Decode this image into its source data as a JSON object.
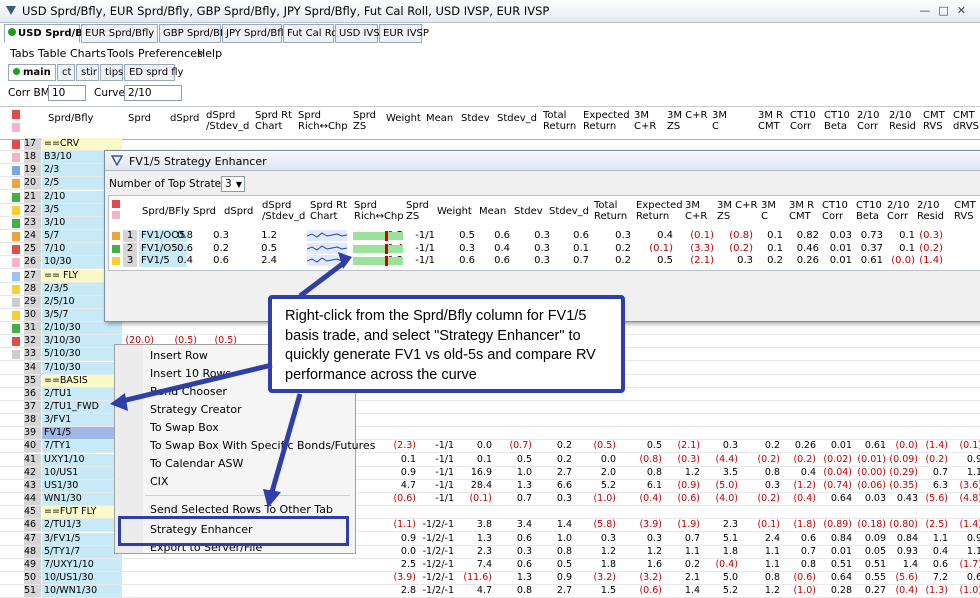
{
  "window": {
    "title": "USD Sprd/Bfly, EUR Sprd/Bfly, GBP Sprd/Bfly, JPY Sprd/Bfly, Fut Cal Roll, USD IVSP, EUR IVSP"
  },
  "tabs": [
    "USD Sprd/Bfly",
    "EUR Sprd/Bfly",
    "GBP Sprd/Bfly",
    "JPY Sprd/Bfly",
    "Fut Cal Roll",
    "USD IVSP",
    "EUR IVSP"
  ],
  "menu": [
    "Tabs",
    "Table",
    "Charts",
    "Tools",
    "Preferences",
    "Help"
  ],
  "subtabs": [
    "main",
    "ct",
    "stir",
    "tips",
    "ED sprd fly"
  ],
  "controls": {
    "corr_label": "Corr BM:",
    "corr_value": "10",
    "curve_label": "Curve:",
    "curve_value": "2/10"
  },
  "grid_headers": [
    "Sprd/Bfly",
    "Sprd",
    "dSprd",
    "dSprd\n/Stdev_d",
    "Sprd Rt\nChart",
    "Sprd\nRich↔Chp",
    "Sprd\nZS",
    "Weight",
    "Mean",
    "Stdev",
    "Stdev_d",
    "Total\nReturn",
    "Expected\nReturn",
    "3M\nC+R",
    "3M C+R\nZS",
    "3M\nC",
    "3M R\nCMT",
    "CT10\nCorr",
    "CT10\nBeta",
    "2/10\nCorr",
    "2/10\nResid",
    "CMT\nRVS",
    "CMT\ndRVS"
  ],
  "rows": [
    {
      "n": "17",
      "label": "==CRV",
      "sec": true
    },
    {
      "n": "18",
      "label": "B3/10"
    },
    {
      "n": "19",
      "label": "2/3"
    },
    {
      "n": "20",
      "label": "2/5"
    },
    {
      "n": "21",
      "label": "2/10"
    },
    {
      "n": "22",
      "label": "3/5"
    },
    {
      "n": "23",
      "label": "3/10"
    },
    {
      "n": "24",
      "label": "5/7"
    },
    {
      "n": "25",
      "label": "7/10"
    },
    {
      "n": "26",
      "label": "10/30"
    },
    {
      "n": "27",
      "label": "== FLY",
      "sec": true
    },
    {
      "n": "28",
      "label": "2/3/5"
    },
    {
      "n": "29",
      "label": "2/5/10"
    },
    {
      "n": "30",
      "label": "3/5/7"
    },
    {
      "n": "31",
      "label": "2/10/30"
    },
    {
      "n": "32",
      "label": "3/10/30",
      "vals": [
        "(20.0)",
        "(0.5)",
        "(0.5)"
      ]
    },
    {
      "n": "33",
      "label": "5/10/30",
      "vals": [
        "(30.5)",
        "(1.4)",
        "(3.0)"
      ]
    },
    {
      "n": "34",
      "label": "7/10/30"
    },
    {
      "n": "35",
      "label": "==BASIS",
      "sec": true
    },
    {
      "n": "36",
      "label": "2/TU1"
    },
    {
      "n": "37",
      "label": "2/TU1_FWD"
    },
    {
      "n": "38",
      "label": "3/FV1"
    },
    {
      "n": "39",
      "label": "FV1/5"
    },
    {
      "n": "40",
      "label": "7/TY1",
      "vals": [
        "(2.3)",
        "-1/1",
        "0.0",
        "(0.7)",
        "0.2",
        "(0.5)",
        "0.5",
        "(2.1)",
        "0.3",
        "0.2",
        "0.26",
        "0.01",
        "0.61",
        "(0.0)",
        "(1.4)",
        "(0.1)"
      ]
    },
    {
      "n": "41",
      "label": "UXY1/10",
      "vals": [
        "0.1",
        "-1/1",
        "0.1",
        "0.5",
        "0.2",
        "0.0",
        "(0.8)",
        "(0.3)",
        "(4.4)",
        "(0.2)",
        "(0.2)",
        "(0.02)",
        "(0.01)",
        "(0.09)",
        "(0.2)",
        "0.9"
      ]
    },
    {
      "n": "42",
      "label": "10/US1",
      "vals": [
        "0.9",
        "-1/1",
        "16.9",
        "1.0",
        "2.7",
        "2.0",
        "0.8",
        "1.2",
        "3.5",
        "0.8",
        "0.4",
        "(0.04)",
        "(0.00)",
        "(0.29)",
        "0.7",
        "1.1"
      ]
    },
    {
      "n": "43",
      "label": "US1/30",
      "vals": [
        "4.7",
        "-1/1",
        "28.4",
        "1.3",
        "6.6",
        "5.2",
        "6.1",
        "(0.9)",
        "(5.0)",
        "0.3",
        "(1.2)",
        "(0.74)",
        "(0.06)",
        "(0.35)",
        "6.3",
        "(3.6)"
      ]
    },
    {
      "n": "44",
      "label": "WN1/30",
      "vals": [
        "(0.6)",
        "-1/1",
        "(0.1)",
        "0.7",
        "0.3",
        "(1.0)",
        "(0.4)",
        "(0.6)",
        "(4.0)",
        "(0.2)",
        "(0.4)",
        "0.64",
        "0.03",
        "0.43",
        "(5.6)",
        "(4.8)"
      ]
    },
    {
      "n": "45",
      "label": "==FUT FLY",
      "sec": true
    },
    {
      "n": "46",
      "label": "2/TU1/3",
      "vals": [
        "(1.1)",
        "-1/2/-1",
        "3.8",
        "3.4",
        "1.4",
        "(5.8)",
        "(3.9)",
        "(1.9)",
        "2.3",
        "(0.1)",
        "(1.8)",
        "(0.89)",
        "(0.18)",
        "(0.80)",
        "(2.5)",
        "(1.4)"
      ]
    },
    {
      "n": "47",
      "label": "3/FV1/5",
      "vals": [
        "0.9",
        "-1/2/-1",
        "1.3",
        "0.6",
        "1.0",
        "0.3",
        "0.3",
        "0.7",
        "5.1",
        "2.4",
        "0.6",
        "0.84",
        "0.09",
        "0.84",
        "1.1",
        "0.9"
      ]
    },
    {
      "n": "48",
      "label": "5/TY1/7",
      "vals": [
        "0.0",
        "-1/2/-1",
        "2.3",
        "0.3",
        "0.8",
        "1.2",
        "1.2",
        "1.1",
        "1.8",
        "1.1",
        "0.7",
        "0.01",
        "0.05",
        "0.93",
        "0.4",
        "1.1"
      ]
    },
    {
      "n": "49",
      "label": "7/UXY1/10",
      "vals": [
        "2.5",
        "-1/2/-1",
        "7.4",
        "0.6",
        "0.5",
        "1.8",
        "1.6",
        "0.2",
        "(0.4)",
        "1.1",
        "0.8",
        "0.51",
        "0.51",
        "1.4",
        "0.6",
        "(1.7)"
      ]
    },
    {
      "n": "50",
      "label": "10/US1/30",
      "vals": [
        "(3.9)",
        "-1/2/-1",
        "(11.6)",
        "1.3",
        "0.9",
        "(3.2)",
        "(3.2)",
        "2.1",
        "5.0",
        "0.8",
        "(0.6)",
        "0.64",
        "0.55",
        "(5.6)",
        "7.2",
        "0.6"
      ]
    },
    {
      "n": "51",
      "label": "10/WN1/30",
      "vals": [
        "2.8",
        "-1/2/-1",
        "4.7",
        "0.8",
        "2.7",
        "1.5",
        "(0.6)",
        "1.4",
        "5.2",
        "1.2",
        "(1.0)",
        "0.28",
        "0.27",
        "(0.4)",
        "(1.3)",
        "(1.0)"
      ]
    }
  ],
  "dialog": {
    "title": "FV1/5 Strategy Enhancer",
    "num_label": "Number of Top Strategies:",
    "num_value": "3",
    "headers": [
      "Sprd/BFly",
      "Sprd",
      "dSprd",
      "dSprd\n/Stdev_d",
      "Sprd Rt\nChart",
      "Sprd\nRich↔Chp",
      "Sprd\nZS",
      "Weight",
      "Mean",
      "Stdev",
      "Stdev_d",
      "Total\nReturn",
      "Expected\nReturn",
      "3M\nC+R",
      "3M C+R\nZS",
      "3M\nC",
      "3M R\nCMT",
      "CT10\nCorr",
      "CT10\nBeta",
      "2/10\nCorr",
      "2/10\nResid",
      "CMT\nRVS"
    ],
    "rows": [
      {
        "n": "1",
        "name": "FV1/OO5",
        "sprd": "0.8",
        "dsprd": "0.3",
        "z": "1.2",
        "zs": "0.5",
        "w": "-1/1",
        "mean": "0.5",
        "stdev": "0.6",
        "stdevd": "0.3",
        "tr": "0.6",
        "er": "0.3",
        "cr": "0.4",
        "crzs": "(0.1)",
        "c": "(0.8)",
        "rcmt": "0.1",
        "ctc": "0.82",
        "ctb": "0.03",
        "tc": "0.73",
        "tr2": "0.1",
        "rvs": "(0.3)"
      },
      {
        "n": "2",
        "name": "FV1/O5",
        "sprd": "0.6",
        "dsprd": "0.2",
        "z": "0.5",
        "zs": "0.4",
        "w": "-1/1",
        "mean": "0.3",
        "stdev": "0.4",
        "stdevd": "0.3",
        "tr": "0.1",
        "er": "0.2",
        "cr": "(0.1)",
        "crzs": "(3.3)",
        "c": "(0.2)",
        "rcmt": "0.1",
        "ctc": "0.46",
        "ctb": "0.01",
        "tc": "0.37",
        "tr2": "0.1",
        "rvs": "(0.2)"
      },
      {
        "n": "3",
        "name": "FV1/5",
        "sprd": "0.4",
        "dsprd": "0.6",
        "z": "2.4",
        "zs": "0.3",
        "w": "-1/1",
        "mean": "0.6",
        "stdev": "0.6",
        "stdevd": "0.3",
        "tr": "0.7",
        "er": "0.2",
        "cr": "0.5",
        "crzs": "(2.1)",
        "c": "0.3",
        "rcmt": "0.2",
        "ctc": "0.26",
        "ctb": "0.01",
        "tc": "0.61",
        "tr2": "(0.0)",
        "rvs": "(1.4)"
      }
    ]
  },
  "callout": {
    "text": "Right-click from the Sprd/Bfly column for FV1/5 basis trade, and select \"Strategy Enhancer\" to quickly generate FV1 vs old-5s and compare RV performance across the curve"
  },
  "context_menu": {
    "items": [
      "Insert Row",
      "Insert 10 Rows",
      "Bond Chooser",
      "Strategy Creator",
      "To Swap Box",
      "To Swap Box With Specific Bonds/Futures",
      "To Calendar ASW",
      "CIX",
      "Send Selected Rows To Other Tab",
      "Strategy Enhancer",
      "Export to Server/File"
    ]
  },
  "colors": {
    "accent": "#2f3ea8",
    "label_bg": "#c8eaf7",
    "section_bg": "#fafac8",
    "negative": "#c00000"
  }
}
